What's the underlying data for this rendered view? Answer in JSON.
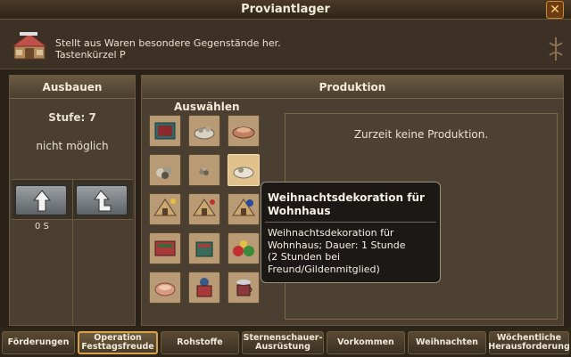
{
  "window": {
    "title": "Proviantlager",
    "close_icon": "close-icon"
  },
  "info": {
    "description": "Stellt aus Waren besondere Gegenstände her.",
    "shortcut": "Tastenkürzel P"
  },
  "upgrade": {
    "header": "Ausbauen",
    "level": "Stufe: 7",
    "status": "nicht möglich",
    "cost": "0 S"
  },
  "production": {
    "header": "Produktion",
    "choose_label": "Auswählen",
    "status": "Zurzeit keine Produktion."
  },
  "tooltip": {
    "title": "Weihnachtsdekoration für Wohnhaus",
    "body_line1": "Weihnachtsdekoration für",
    "body_line2": "Wohnhaus; Dauer: 1 Stunde",
    "body_line3": "(2 Stunden bei",
    "body_line4": "Freund/Gildenmitglied)"
  },
  "items": [
    {
      "icon": "stone-chest-icon"
    },
    {
      "icon": "mortar-ore-icon"
    },
    {
      "icon": "bread-loaf-icon"
    },
    {
      "icon": "rubble-pile-icon"
    },
    {
      "icon": "dust-pile-icon"
    },
    {
      "icon": "ore-pile-icon"
    },
    {
      "icon": "tent-decoration-icon"
    },
    {
      "icon": "tent-decoration-icon"
    },
    {
      "icon": "tent-decoration-icon"
    },
    {
      "icon": "ornament-crate-icon"
    },
    {
      "icon": "stocking-icon"
    },
    {
      "icon": "gift-bags-icon"
    },
    {
      "icon": "cookie-icon"
    },
    {
      "icon": "sweater-icon"
    },
    {
      "icon": "hot-drink-icon"
    }
  ],
  "tabs": [
    {
      "label": "Förderungen"
    },
    {
      "label": "Operation Festtagsfreude",
      "active": true
    },
    {
      "label": "Rohstoffe"
    },
    {
      "label": "Sternenschauer-Ausrüstung"
    },
    {
      "label": "Vorkommen"
    },
    {
      "label": "Weihnachten"
    },
    {
      "label": "Wöchentliche Herausforderung"
    }
  ],
  "colors": {
    "accent": "#d8a14a",
    "panel": "#4a3f30",
    "tooltip_bg": "#181614"
  }
}
